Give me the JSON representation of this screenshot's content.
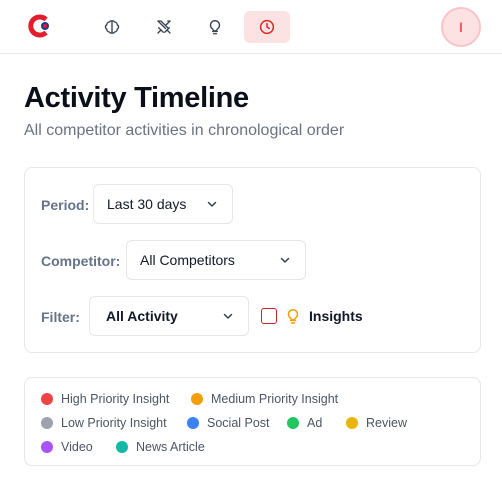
{
  "nav": {
    "items": [
      {
        "name": "brain-icon"
      },
      {
        "name": "swords-icon"
      },
      {
        "name": "lightbulb-icon"
      },
      {
        "name": "clock-icon",
        "active": true
      }
    ],
    "avatar_initial": "I",
    "accent_color": "#dc2626",
    "active_bg_color": "#fde2e4"
  },
  "header": {
    "title": "Activity Timeline",
    "subtitle": "All competitor activities in chronological order"
  },
  "filters": {
    "period_label": "Period:",
    "period_value": "Last 30 days",
    "competitor_label": "Competitor:",
    "competitor_value": "All Competitors",
    "filter_label": "Filter:",
    "filter_value": "All Activity",
    "insights_label": "Insights",
    "insights_checked": false
  },
  "legend": [
    {
      "label": "High Priority Insight",
      "color": "#ef4444"
    },
    {
      "label": "Medium Priority Insight",
      "color": "#f59e0b"
    },
    {
      "label": "Low Priority Insight",
      "color": "#9ca3af"
    },
    {
      "label": "Social Post",
      "color": "#3b82f6"
    },
    {
      "label": "Ad",
      "color": "#22c55e"
    },
    {
      "label": "Review",
      "color": "#eab308"
    },
    {
      "label": "Video",
      "color": "#a855f7"
    },
    {
      "label": "News Article",
      "color": "#14b8a6"
    }
  ]
}
